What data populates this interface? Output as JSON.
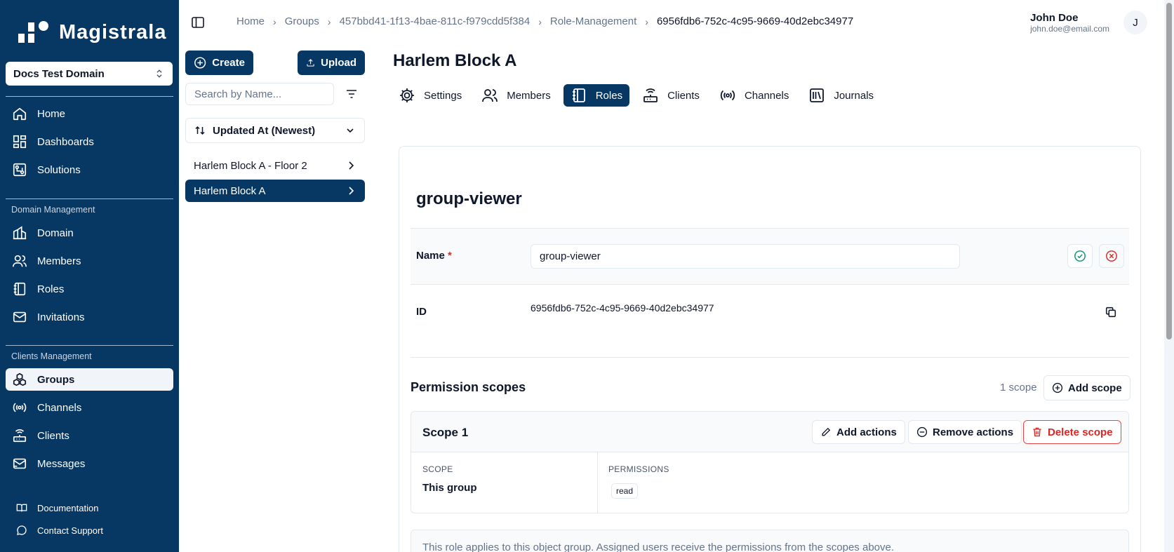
{
  "app": {
    "name": "Magistrala"
  },
  "sidebar": {
    "domain": "Docs Test Domain",
    "main_items": [
      {
        "label": "Home",
        "icon": "home-icon"
      },
      {
        "label": "Dashboards",
        "icon": "dashboard-icon"
      },
      {
        "label": "Solutions",
        "icon": "solutions-icon"
      }
    ],
    "domain_section": "Domain Management",
    "domain_items": [
      {
        "label": "Domain",
        "icon": "domain-icon"
      },
      {
        "label": "Members",
        "icon": "members-icon"
      },
      {
        "label": "Roles",
        "icon": "roles-icon"
      },
      {
        "label": "Invitations",
        "icon": "mail-icon"
      }
    ],
    "clients_section": "Clients Management",
    "clients_items": [
      {
        "label": "Groups",
        "icon": "groups-icon",
        "active": true
      },
      {
        "label": "Channels",
        "icon": "channels-icon"
      },
      {
        "label": "Clients",
        "icon": "clients-icon"
      },
      {
        "label": "Messages",
        "icon": "messages-icon"
      }
    ],
    "footer_items": [
      {
        "label": "Documentation",
        "icon": "book-icon"
      },
      {
        "label": "Contact Support",
        "icon": "chat-icon"
      }
    ]
  },
  "breadcrumb": [
    "Home",
    "Groups",
    "457bbd41-1f13-4bae-811c-f979cdd5f384",
    "Role-Management",
    "6956fdb6-752c-4c95-9669-40d2ebc34977"
  ],
  "user": {
    "name": "John Doe",
    "email": "john.doe@email.com",
    "initial": "J"
  },
  "groups_panel": {
    "create_label": "Create",
    "upload_label": "Upload",
    "search_placeholder": "Search by Name...",
    "sort_label": "Updated At (Newest)",
    "items": [
      {
        "label": "Harlem Block A - Floor 2",
        "active": false
      },
      {
        "label": "Harlem Block A",
        "active": true
      }
    ]
  },
  "group": {
    "title": "Harlem Block A",
    "tabs": [
      {
        "label": "Settings",
        "icon": "settings-icon"
      },
      {
        "label": "Members",
        "icon": "members-icon"
      },
      {
        "label": "Roles",
        "icon": "roles-icon",
        "active": true
      },
      {
        "label": "Clients",
        "icon": "clients-icon"
      },
      {
        "label": "Channels",
        "icon": "channels-icon"
      },
      {
        "label": "Journals",
        "icon": "journals-icon"
      }
    ]
  },
  "role": {
    "title": "group-viewer",
    "name_label": "Name",
    "required_mark": "*",
    "name_value": "group-viewer",
    "id_label": "ID",
    "id_value": "6956fdb6-752c-4c95-9669-40d2ebc34977",
    "permissions_title": "Permission scopes",
    "scope_count": "1 scope",
    "add_scope_label": "Add scope",
    "scopes": [
      {
        "name": "Scope 1",
        "add_actions_label": "Add actions",
        "remove_actions_label": "Remove actions",
        "delete_label": "Delete scope",
        "scope_col_label": "SCOPE",
        "scope_value": "This group",
        "permissions_col_label": "PERMISSIONS",
        "permissions": [
          "read"
        ]
      }
    ],
    "info": "This role applies to this object group. Assigned users receive the permissions from the scopes above."
  },
  "colors": {
    "sidebar_bg": "#073763",
    "primary": "#073763",
    "danger": "#dc2626",
    "success": "#059669"
  }
}
